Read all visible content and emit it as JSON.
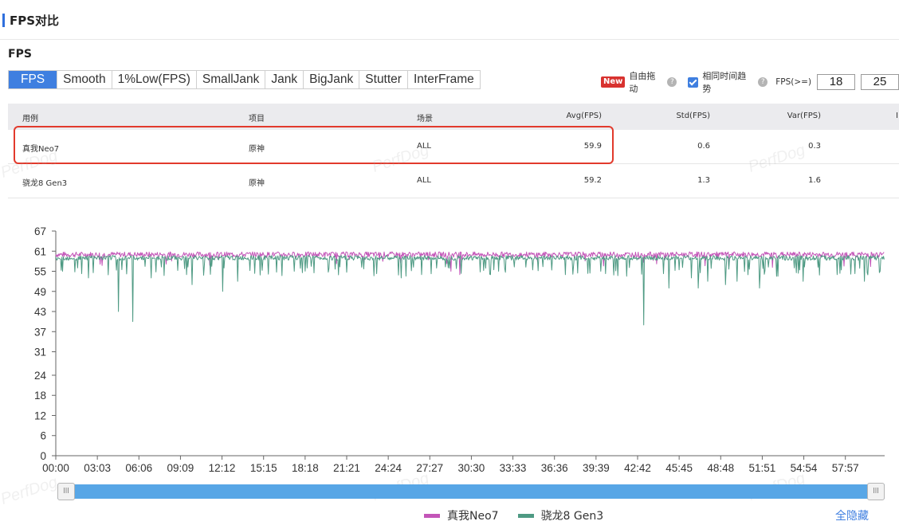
{
  "section": {
    "title": "FPS对比"
  },
  "panel": {
    "label": "FPS"
  },
  "tabs": [
    "FPS",
    "Smooth",
    "1%Low(FPS)",
    "SmallJank",
    "Jank",
    "BigJank",
    "Stutter",
    "InterFrame"
  ],
  "controls": {
    "new_badge": "New",
    "free_drag": "自由拖动",
    "same_time_trend": "相同时间趋势",
    "fps_ge_label": "FPS(>=)",
    "fps_ge_value_1": "18",
    "fps_ge_value_2": "25",
    "help_glyph": "?"
  },
  "table": {
    "headers": [
      "用例",
      "项目",
      "场景",
      "Avg(FPS)",
      "Std(FPS)",
      "Var(FPS)",
      "I"
    ],
    "rows": [
      [
        "真我Neo7",
        "原神",
        "ALL",
        "59.9",
        "0.6",
        "0.3"
      ],
      [
        "骁龙8 Gen3",
        "原神",
        "ALL",
        "59.2",
        "1.3",
        "1.6"
      ]
    ]
  },
  "watermark": "PerfDog",
  "slider": {
    "handle_glyph": "lll"
  },
  "legend": {
    "hide_all": "全隐藏"
  },
  "chart_data": {
    "type": "line",
    "title": "",
    "xlabel": "",
    "ylabel": "",
    "y_ticks": [
      0,
      6,
      12,
      18,
      24,
      31,
      37,
      43,
      49,
      55,
      61,
      67
    ],
    "ylim": [
      0,
      67
    ],
    "x_ticks": [
      "00:00",
      "03:03",
      "06:06",
      "09:09",
      "12:12",
      "15:15",
      "18:18",
      "21:21",
      "24:24",
      "27:27",
      "30:30",
      "33:33",
      "36:36",
      "39:39",
      "42:42",
      "45:45",
      "48:48",
      "51:51",
      "54:54",
      "57:57"
    ],
    "xlim_seconds": [
      0,
      3650
    ],
    "grid": false,
    "series": [
      {
        "name": "真我Neo7",
        "color": "#c355b8",
        "baseline": 60,
        "dips": [
          [
            1740,
            55
          ],
          [
            1780,
            54
          ],
          [
            2120,
            58
          ]
        ]
      },
      {
        "name": "骁龙8 Gen3",
        "color": "#4e9a83",
        "baseline": 59,
        "dips": [
          [
            30,
            55
          ],
          [
            95,
            56
          ],
          [
            145,
            53
          ],
          [
            275,
            43
          ],
          [
            340,
            40
          ],
          [
            420,
            53
          ],
          [
            575,
            54
          ],
          [
            600,
            51
          ],
          [
            735,
            49
          ],
          [
            800,
            52
          ],
          [
            1050,
            55
          ],
          [
            1520,
            53
          ],
          [
            1610,
            54
          ],
          [
            1950,
            55
          ],
          [
            2800,
            53
          ],
          [
            2590,
            39
          ],
          [
            2700,
            50
          ],
          [
            2830,
            50
          ],
          [
            2870,
            52
          ],
          [
            2950,
            51
          ],
          [
            3000,
            52
          ],
          [
            3100,
            50
          ],
          [
            3290,
            52
          ],
          [
            3440,
            54
          ],
          [
            3560,
            52
          ],
          [
            3630,
            55
          ]
        ]
      }
    ]
  },
  "colors": {
    "accent": "#3f7fe0",
    "highlight": "#e23a2c",
    "slider": "#57a6e6"
  }
}
